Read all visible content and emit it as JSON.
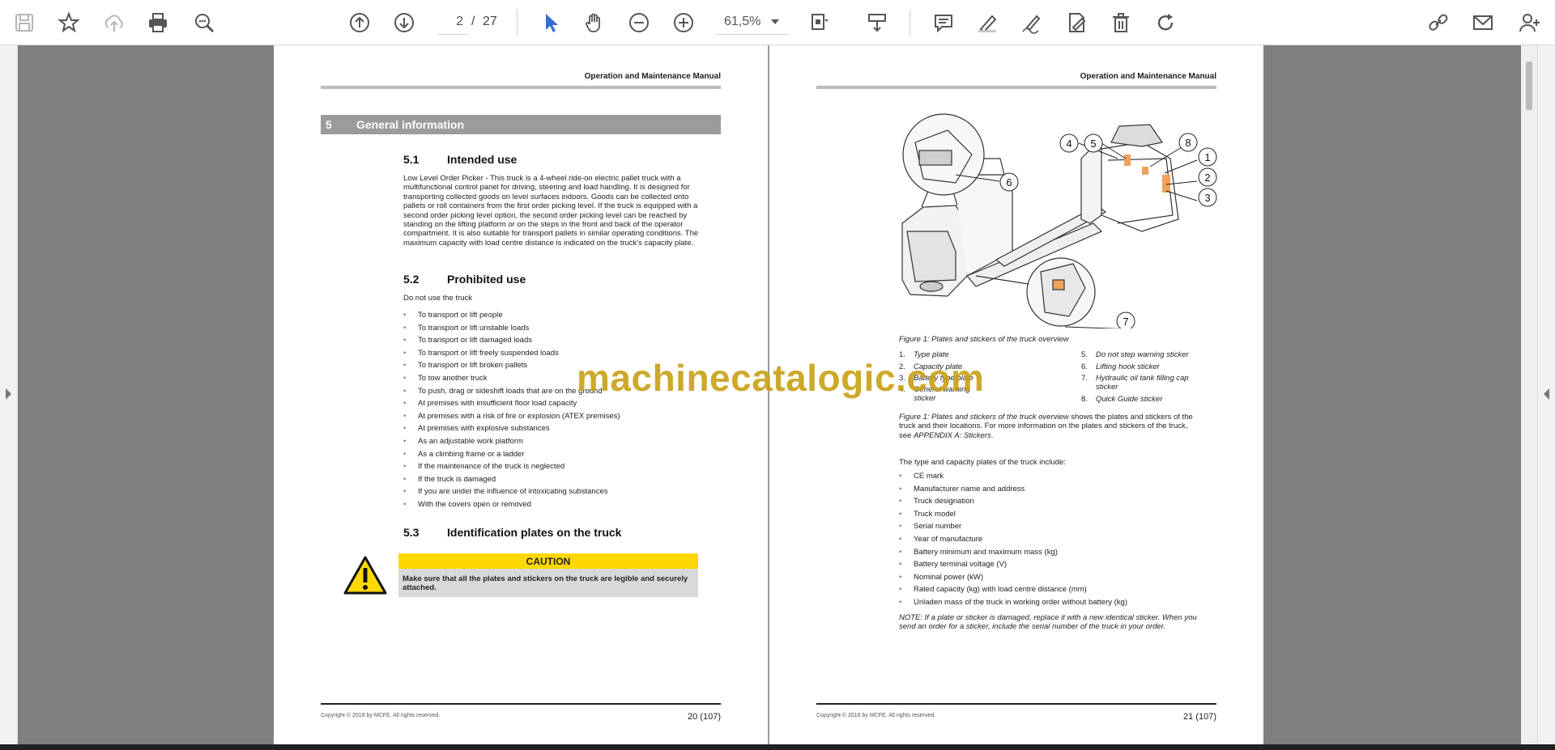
{
  "toolbar": {
    "page_current": "2",
    "page_separator": "/",
    "page_total": "27",
    "zoom": "61,5%",
    "icons": [
      "save-icon",
      "bookmark-star-icon",
      "cloud-upload-icon",
      "print-icon",
      "find-icon",
      "page-up-icon",
      "page-down-icon",
      "select-cursor-icon",
      "hand-icon",
      "zoom-out-icon",
      "zoom-in-icon",
      "fit-page-icon",
      "scroll-mode-icon",
      "comment-icon",
      "highlight-pen-icon",
      "draw-icon",
      "edit-sign-icon",
      "delete-icon",
      "rotate-icon",
      "share-link-icon",
      "email-icon",
      "add-user-icon"
    ]
  },
  "left_page": {
    "header": "Operation and Maintenance Manual",
    "section_num": "5",
    "section_title": "General information",
    "s51_num": "5.1",
    "s51_title": "Intended use",
    "s51_text": "Low Level Order Picker - This truck is a 4-wheel ride-on electric pallet truck with a multifunctional control panel for driving, steering and load handling. It is designed for transporting collected goods on level surfaces indoors. Goods can be collected onto pallets or roll containers from the first order picking level. If the truck is equipped with a second order picking level option, the second order picking level can be reached by standing on the lifting platform or on the steps in the front and back of the operator compartment. It is also suitable for transport pallets in similar operating conditions. The maximum capacity with load centre distance is indicated on the truck's capacity plate.",
    "s52_num": "5.2",
    "s52_title": "Prohibited use",
    "s52_intro": "Do not use the truck",
    "s52_items": [
      "To transport or lift people",
      "To transport or lift unstable loads",
      "To transport or lift damaged loads",
      "To transport or lift freely suspended loads",
      "To transport or lift broken pallets",
      "To tow another truck",
      "To push, drag or sideshift loads that are on the ground",
      "At premises with insufficient floor load capacity",
      "At premises with a risk of fire or explosion (ATEX premises)",
      "At premises with explosive substances",
      "As an adjustable work platform",
      "As a climbing frame or a ladder",
      "If the maintenance of the truck is neglected",
      "If the truck is damaged",
      "If you are under the influence of intoxicating substances",
      "With the covers open or removed"
    ],
    "s53_num": "5.3",
    "s53_title": "Identification plates on the truck",
    "caution_label": "CAUTION",
    "caution_text": "Make sure that all the plates and stickers on the truck are legible and securely attached.",
    "footer_copy": "Copyright © 2018 by MCFE. All rights reserved.",
    "footer_page": "20 (107)"
  },
  "right_page": {
    "header": "Operation and Maintenance Manual",
    "callouts": [
      "1",
      "2",
      "3",
      "4",
      "5",
      "6",
      "7",
      "8"
    ],
    "figure_caption": "Figure 1: Plates and stickers of the truck overview",
    "legend_left": [
      {
        "n": "1.",
        "t": "Type plate"
      },
      {
        "n": "2.",
        "t": "Capacity plate"
      },
      {
        "n": "3.",
        "t": "Battery type plate"
      },
      {
        "n": "4.",
        "t": "General warning sticker"
      }
    ],
    "legend_right": [
      {
        "n": "5.",
        "t": "Do not step warning sticker"
      },
      {
        "n": "6.",
        "t": "Lifting hook sticker"
      },
      {
        "n": "7.",
        "t": "Hydraulic oil tank filling cap sticker"
      },
      {
        "n": "8.",
        "t": "Quick Guide sticker"
      }
    ],
    "ref_text_a": "Figure 1: Plates and stickers of the truck overview",
    "ref_text_b": " shows the plates and stickers of the truck and their locations. For more information on the plates and stickers of the truck, see ",
    "ref_text_c": "APPENDIX A: Stickers",
    "ref_text_d": ".",
    "plates_intro": "The type and capacity plates of the truck include:",
    "plates_items": [
      "CE mark",
      "Manufacturer name and address",
      "Truck designation",
      "Truck model",
      "Serial number",
      "Year of manufacture",
      "Battery minimum and maximum mass (kg)",
      "Battery terminal voltage (V)",
      "Nominal power (kW)",
      "Rated capacity (kg) with load centre distance (mm)",
      "Unladen mass of the truck in working order without battery (kg)"
    ],
    "note": "NOTE: If a plate or sticker is damaged, replace it with a new identical sticker. When you send an order for a sticker, include the serial number of the truck in your order.",
    "footer_copy": "Copyright © 2018 by MCFE. All rights reserved.",
    "footer_page": "21 (107)"
  },
  "watermark": "machinecatalogic.com",
  "colors": {
    "caution_yellow": "#ffd800",
    "section_grey": "#9b9b9b",
    "watermark_gold": "#c9a21a",
    "callout_orange": "#f2a25c"
  }
}
